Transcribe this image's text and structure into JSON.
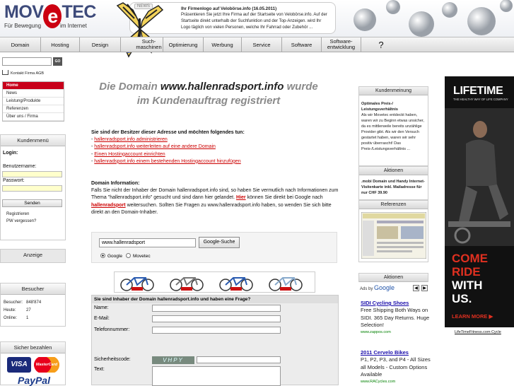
{
  "header": {
    "logo_text": "MOVETEC",
    "logo_sub_left": "Für Bewegung",
    "logo_sub_right": "im Internet",
    "news_label": "NEWS",
    "news_title": "Ihr Firmenlogo auf Velobörse.info (16.05.2011)",
    "news_body": "Präsentieren Sie jetzt Ihre Firma auf der Startseite von Velobörse.info. Auf der Startseite direkt unterhalb der Suchfunktion und der Top-Anzeigen. wird Ihr Logo täglich von vielen Personen, welche Ihr Fahrrad oder Zubehör ..."
  },
  "nav": {
    "items": [
      {
        "label": "Domain"
      },
      {
        "label": "Hosting"
      },
      {
        "label": "Design"
      },
      {
        "label": "Such-\nmaschinen"
      },
      {
        "label": "Optimierung"
      },
      {
        "label": "Werbung"
      },
      {
        "label": "Service"
      },
      {
        "label": "Software"
      },
      {
        "label": "Software-\nentwicklung"
      },
      {
        "label": "?"
      }
    ]
  },
  "sidebar": {
    "search_go": "GO",
    "toplinks": "Kontakt  Firma  AGB",
    "menu": [
      "Home",
      "News",
      "Leistung/Produkte",
      "Referenzen",
      "Über uns / Firma"
    ],
    "kunden_title": "Kundenmenü",
    "login_label": "Login:",
    "user_label": "Benutzername:",
    "pass_label": "Passwort:",
    "send_label": "Senden",
    "register_link": "Registrieren",
    "forgot_link": "PW vergessen?",
    "anzeige_title": "Anzeige",
    "besucher_title": "Besucher",
    "besucher_rows": [
      {
        "label": "Besucher:",
        "value": "848'874"
      },
      {
        "label": "Heute:",
        "value": "27"
      },
      {
        "label": "Online:",
        "value": "1"
      }
    ],
    "pay_title": "Sicher bezahlen",
    "cards": [
      "VISA",
      "MasterCard",
      "PayPal"
    ]
  },
  "main": {
    "headline_1": "Die Domain",
    "headline_domain": "www.hallenradsport.info",
    "headline_2": "wurde",
    "headline_3": "im Kundenauftrag registriert",
    "owner_q": "Sie sind der Besitzer dieser Adresse und möchten folgendes tun:",
    "owner_links": [
      "hallenradsport.info administrieren",
      "hallenradsport.info weiterleiten auf eine andere Domain",
      "Einen Hostingaccount einrichten",
      "hallenradsport.info einem bestehenden Hostingaccount hinzufügen"
    ],
    "info_title": "Domain Information:",
    "info_1": "Falls Sie nicht der Inhaber der Domain hallenradsport.info sind, so haben Sie vermutlich nach Informationen zum Thema \"hallenradsport.info\" gesucht und sind dann hier gelandet.",
    "info_hier": "Hier",
    "info_2": "können Sie direkt bei Google nach",
    "info_link": "hallenradsport",
    "info_3": "weitersuchen. Sollten Sie Fragen zu www.hallenradsport.info haben, so wenden Sie sich bitte direkt an den Domain-Inhaber.",
    "search_value": "www.hallenradsport",
    "search_button": "Google-Suche",
    "radio_google": "Google",
    "radio_movetec": "Movetec",
    "form_title": "Sie sind Inhaber der Domain hallenradsport.info und haben eine Frage?",
    "form_fields": [
      "Name:",
      "E-Mail:",
      "Telefonnummer:",
      "Sicherheitscode:",
      "Text:"
    ],
    "captcha_text": "VHPY"
  },
  "right": {
    "kundenmeinung_title": "Kundenmeinung",
    "kundenmeinung_head": "Optimales Preis-/ Leistungsverhältnis",
    "kundenmeinung_text": "Als wir Movetec entdeckt haben, waren wir zu Beginn etwas unsicher, da es mittlerweile bereits unzählige Provider gibt. Als wir den Versuch gestartet haben, waren wir sehr positiv überrascht! Das Preis-/Leistungsverhältnis ...",
    "aktionen_title": "Aktionen",
    "aktionen_text": ".mobi Domain und Handy Internet-Visitenkarte inkl. Mailadresse für nur CHF 39.90",
    "referenzen_title": "Referenzen",
    "aktionen2_title": "Aktionen",
    "ads_by": "Ads by",
    "ads_google": "Google",
    "ads": [
      {
        "title": "SIDI Cycling Shoes",
        "desc": "Free Shipping Both Ways on SIDI. 365 Day Returns. Huge Selection!",
        "url": "www.zappos.com"
      },
      {
        "title": "2011 Cervelo Bikes",
        "desc": "P1, P2, P3, and P4 - All Sizes all Models - Custom Options Available",
        "url": "www.RACycles.com"
      }
    ],
    "lt_logo": "LIFETIME",
    "lt_tagline": "THE HEALTHY WAY OF LIFE COMPANY",
    "lt_line1": "COME",
    "lt_line2": "RIDE",
    "lt_line3": "WITH",
    "lt_line4": "US.",
    "lt_learn": "LEARN MORE ▶",
    "lt_link": "LifeTimeFitness.com Cycle"
  }
}
